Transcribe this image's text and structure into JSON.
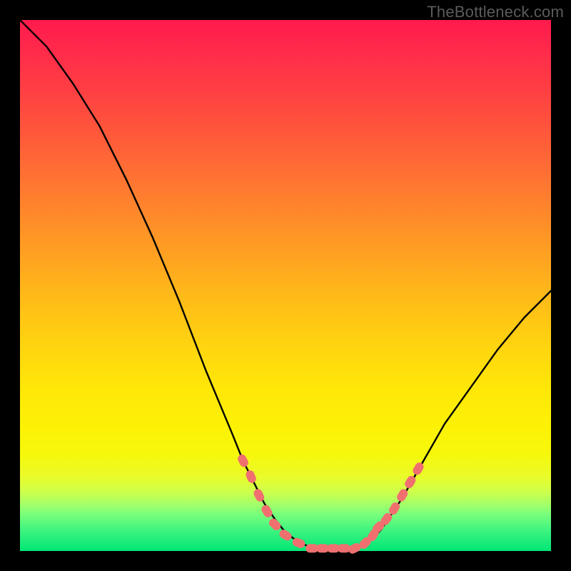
{
  "watermark": "TheBottleneck.com",
  "chart_data": {
    "type": "line",
    "title": "",
    "xlabel": "",
    "ylabel": "",
    "xlim": [
      0,
      1
    ],
    "ylim": [
      0,
      1
    ],
    "series": [
      {
        "name": "curve",
        "color": "#000000",
        "x": [
          0.0,
          0.05,
          0.1,
          0.15,
          0.2,
          0.25,
          0.3,
          0.35,
          0.4,
          0.42,
          0.44,
          0.46,
          0.48,
          0.5,
          0.52,
          0.54,
          0.56,
          0.58,
          0.6,
          0.62,
          0.64,
          0.66,
          0.68,
          0.7,
          0.72,
          0.76,
          0.8,
          0.85,
          0.9,
          0.95,
          1.0
        ],
        "y": [
          1.0,
          0.95,
          0.88,
          0.8,
          0.7,
          0.59,
          0.47,
          0.34,
          0.22,
          0.17,
          0.13,
          0.09,
          0.06,
          0.035,
          0.02,
          0.01,
          0.005,
          0.005,
          0.005,
          0.005,
          0.01,
          0.02,
          0.04,
          0.07,
          0.1,
          0.17,
          0.24,
          0.31,
          0.38,
          0.44,
          0.49
        ]
      },
      {
        "name": "markers",
        "color": "#f07070",
        "x": [
          0.42,
          0.435,
          0.45,
          0.465,
          0.48,
          0.5,
          0.525,
          0.55,
          0.57,
          0.59,
          0.61,
          0.63,
          0.65,
          0.665,
          0.675,
          0.69,
          0.705,
          0.72,
          0.735,
          0.75
        ],
        "y": [
          0.17,
          0.14,
          0.105,
          0.075,
          0.05,
          0.03,
          0.015,
          0.005,
          0.005,
          0.005,
          0.005,
          0.005,
          0.015,
          0.03,
          0.045,
          0.06,
          0.08,
          0.105,
          0.13,
          0.155
        ]
      }
    ]
  },
  "colors": {
    "frame": "#000000",
    "curve": "#000000",
    "markers": "#f07070"
  }
}
